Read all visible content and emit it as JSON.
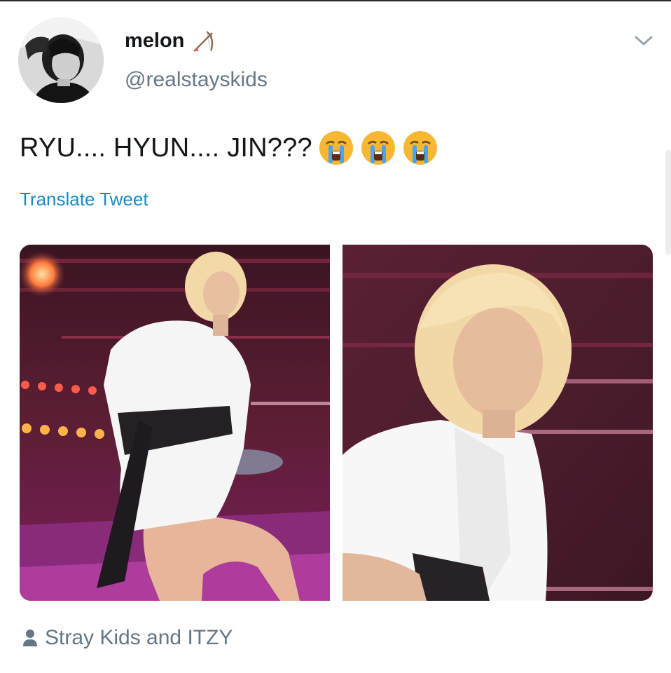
{
  "tweet": {
    "display_name": "melon",
    "handle": "@realstayskids",
    "name_emoji_icon": "bow-and-arrow-icon",
    "text": "RYU.... HYUN.... JIN???",
    "emojis": [
      "crying-face-icon",
      "crying-face-icon",
      "crying-face-icon"
    ],
    "translate_label": "Translate Tweet",
    "context_label": "Stray Kids and ITZY"
  },
  "colors": {
    "link": "#1b8bc0",
    "secondary_text": "#657786",
    "primary_text": "#14171a"
  }
}
